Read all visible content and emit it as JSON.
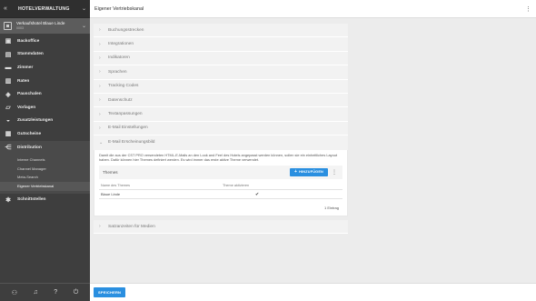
{
  "sidebar": {
    "app_title": "HOTELVERWALTUNG",
    "hotel": {
      "name": "Verkaufshotel Blaue Linde",
      "sub": "0003"
    },
    "items": [
      {
        "label": "Backoffice",
        "icon": "briefcase-icon",
        "glyph": "▣"
      },
      {
        "label": "Stammdaten",
        "icon": "document-icon",
        "glyph": "▤"
      },
      {
        "label": "Zimmer",
        "icon": "bed-icon",
        "glyph": "▬"
      },
      {
        "label": "Raten",
        "icon": "rates-icon",
        "glyph": "▥"
      },
      {
        "label": "Pauschalen",
        "icon": "tag-icon",
        "glyph": "◈"
      },
      {
        "label": "Vorlagen",
        "icon": "template-icon",
        "glyph": "▱"
      },
      {
        "label": "Zusatzleistungen",
        "icon": "service-icon",
        "glyph": "◒"
      },
      {
        "label": "Gutscheine",
        "icon": "gift-icon",
        "glyph": "▦"
      },
      {
        "label": "Distribution",
        "icon": "share-icon",
        "glyph": "⋲"
      },
      {
        "label": "Schnittstellen",
        "icon": "plug-icon",
        "glyph": "✱"
      }
    ],
    "subitems": [
      "Interne Channels",
      "Channel Manager",
      "Meta-Search",
      "Eigener Vertriebskanal"
    ]
  },
  "topbar": {
    "title": "Eigener Vertriebskanal"
  },
  "sections": [
    "Buchungsstrecken",
    "Integrationen",
    "Indikatoren",
    "Sprachen",
    "Tracking Codes",
    "Datenschutz",
    "Textanpassungen",
    "E-Mail Einstellungen"
  ],
  "open_section": {
    "title": "E-Mail Erscheinungsbild",
    "description": "Damit die aus der CST PRO versendeten HTML-E-Mails an den Look and Feel des Hotels angepasst werden können, sollen sie ein einheitliches Layout haben. Dafür können hier Themes definiert werden. Es wird immer das erste aktive Theme verwendet.",
    "themes_label": "Themes",
    "add_button": "HINZUFÜGEN",
    "table": {
      "headers": [
        "Name des Themes",
        "Theme aktivieren"
      ],
      "rows": [
        {
          "name": "Blaue Linde",
          "active": "✔"
        }
      ]
    },
    "count": "1 Eintrag"
  },
  "last_section": "Satzanzeiten für Medien",
  "save_button": "SPEICHERN"
}
